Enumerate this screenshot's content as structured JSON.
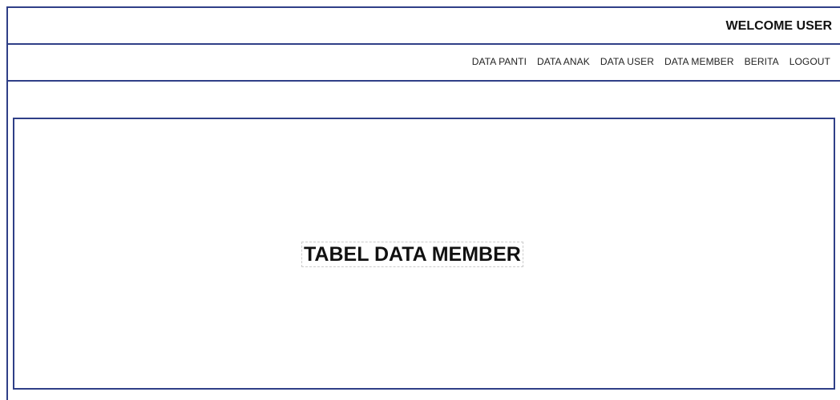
{
  "header": {
    "welcome_text": "WELCOME USER"
  },
  "nav": {
    "items": [
      {
        "label": "DATA PANTI"
      },
      {
        "label": "DATA ANAK"
      },
      {
        "label": "DATA USER"
      },
      {
        "label": "DATA MEMBER"
      },
      {
        "label": "BERITA"
      },
      {
        "label": "LOGOUT"
      }
    ]
  },
  "main": {
    "title": "TABEL DATA MEMBER"
  },
  "colors": {
    "border": "#2f3f87",
    "text": "#111111",
    "background": "#ffffff"
  }
}
